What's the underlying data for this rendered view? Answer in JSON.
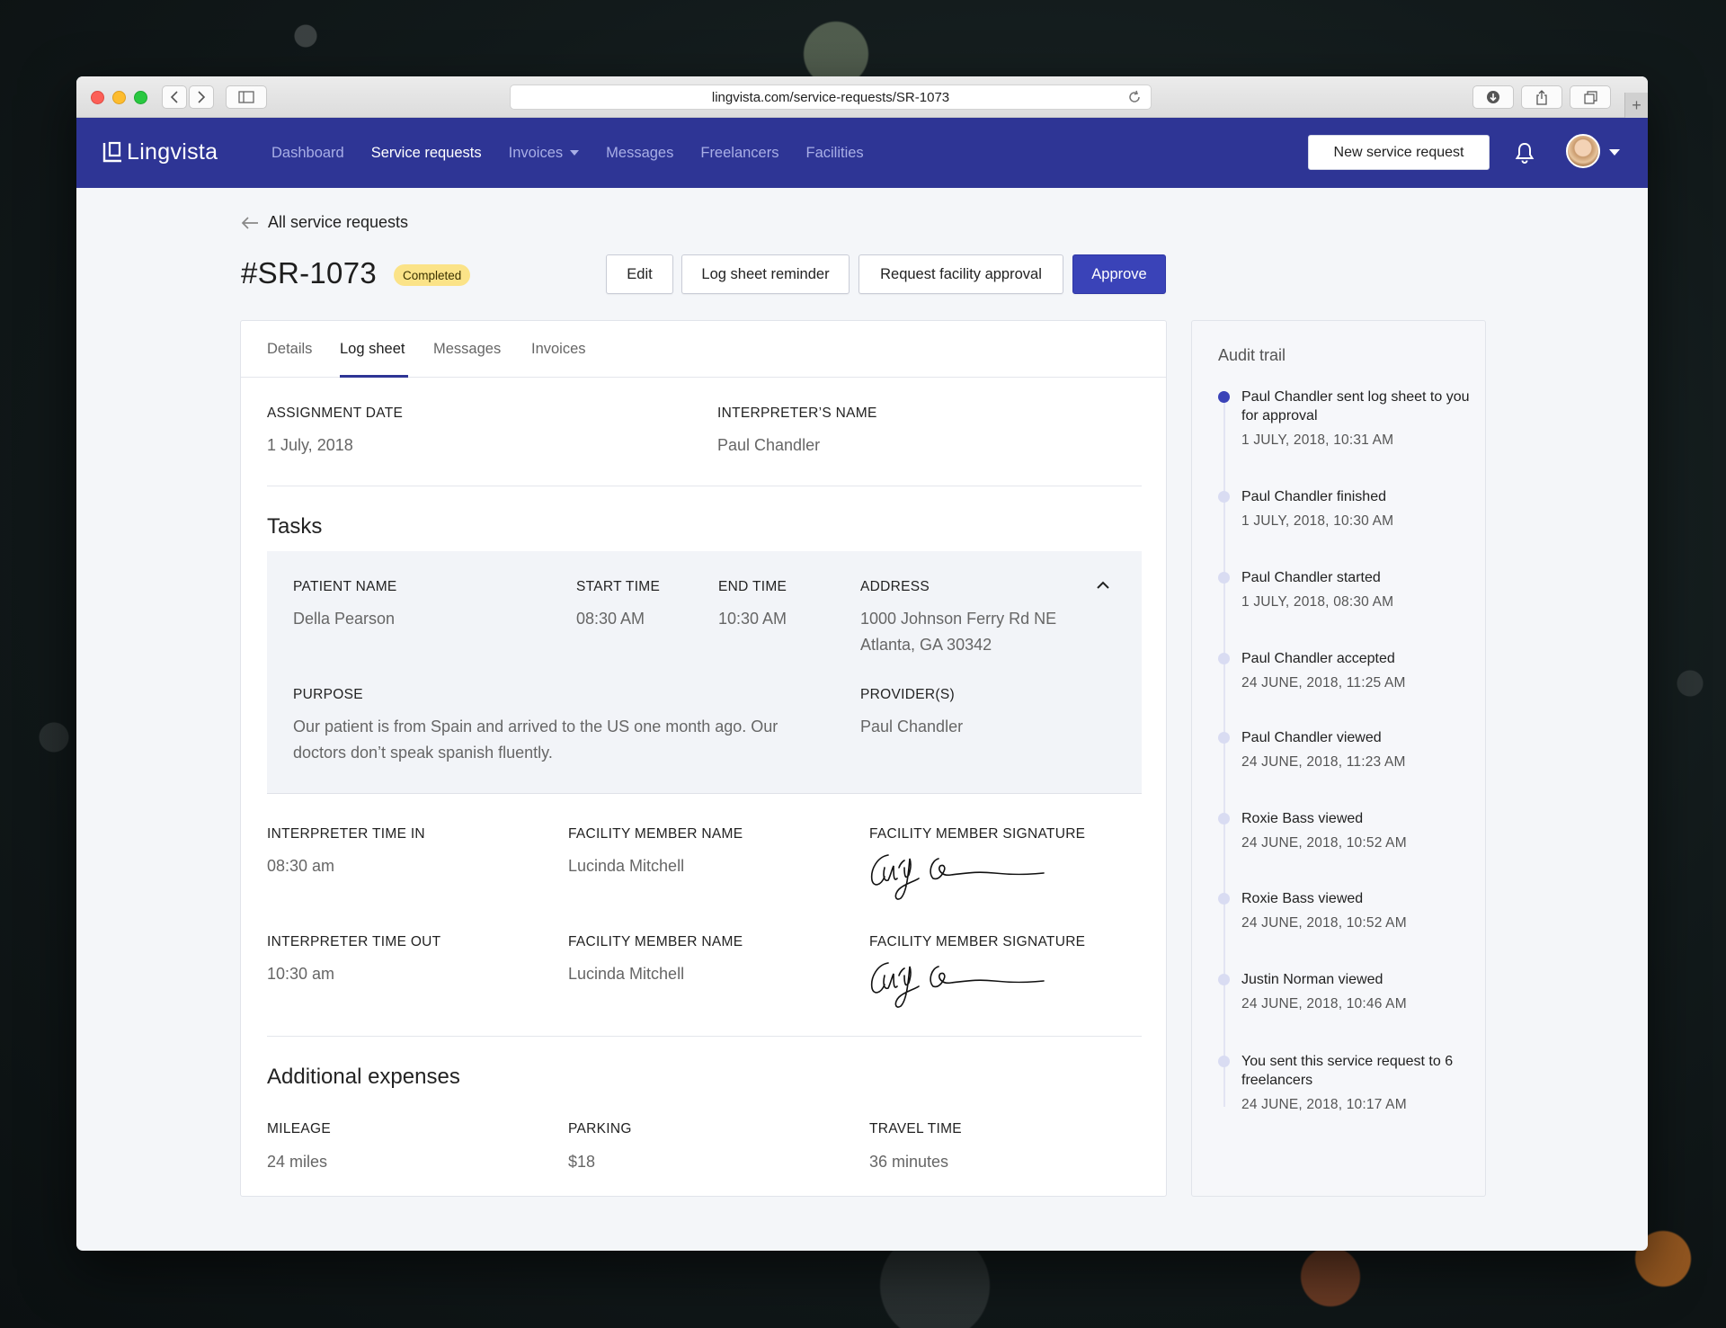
{
  "browser": {
    "url": "lingvista.com/service-requests/SR-1073"
  },
  "app": {
    "logo": "Lingvista",
    "nav": [
      {
        "label": "Dashboard"
      },
      {
        "label": "Service requests"
      },
      {
        "label": "Invoices"
      },
      {
        "label": "Messages"
      },
      {
        "label": "Freelancers"
      },
      {
        "label": "Facilities"
      }
    ],
    "new_request_label": "New service request"
  },
  "page": {
    "back_label": "All service requests",
    "title": "#SR-1073",
    "status": "Completed",
    "actions": {
      "edit": "Edit",
      "reminder": "Log sheet reminder",
      "facility_approval": "Request facility approval",
      "approve": "Approve"
    },
    "tabs": [
      "Details",
      "Log sheet",
      "Messages",
      "Invoices"
    ]
  },
  "log_sheet": {
    "assignment_date_label": "ASSIGNMENT DATE",
    "assignment_date": "1 July, 2018",
    "interpreter_label": "INTERPRETER’S NAME",
    "interpreter": "Paul Chandler",
    "tasks_title": "Tasks",
    "task": {
      "patient_label": "PATIENT NAME",
      "patient": "Della Pearson",
      "start_label": "START TIME",
      "start": "08:30 AM",
      "end_label": "END TIME",
      "end": "10:30 AM",
      "address_label": "ADDRESS",
      "address_line1": "1000 Johnson Ferry Rd NE",
      "address_line2": "Atlanta, GA 30342",
      "purpose_label": "PURPOSE",
      "purpose_line1": "Our patient is from Spain and arrived to the US one month ago. Our",
      "purpose_line2": "doctors don’t speak spanish fluently.",
      "providers_label": "PROVIDER(S)",
      "providers": "Paul Chandler"
    },
    "time_in": {
      "label": "INTERPRETER TIME IN",
      "value": "08:30 am",
      "member_label": "FACILITY MEMBER NAME",
      "member": "Lucinda Mitchell",
      "signature_label": "FACILITY MEMBER SIGNATURE"
    },
    "time_out": {
      "label": "INTERPRETER TIME OUT",
      "value": "10:30 am",
      "member_label": "FACILITY MEMBER NAME",
      "member": "Lucinda Mitchell",
      "signature_label": "FACILITY MEMBER SIGNATURE"
    },
    "expenses_title": "Additional expenses",
    "expenses": {
      "mileage_label": "MILEAGE",
      "mileage": "24 miles",
      "parking_label": "PARKING",
      "parking": "$18",
      "travel_label": "TRAVEL TIME",
      "travel": "36 minutes"
    }
  },
  "audit": {
    "title": "Audit trail",
    "events": [
      {
        "text": "Paul Chandler sent log sheet to you for approval",
        "time": "1 JULY, 2018, 10:31 AM"
      },
      {
        "text": "Paul Chandler finished",
        "time": "1 JULY, 2018, 10:30 AM"
      },
      {
        "text": "Paul Chandler started",
        "time": "1 JULY, 2018, 08:30 AM"
      },
      {
        "text": "Paul Chandler accepted",
        "time": "24 JUNE, 2018, 11:25 AM"
      },
      {
        "text": "Paul Chandler viewed",
        "time": "24 JUNE, 2018, 11:23 AM"
      },
      {
        "text": "Roxie Bass viewed",
        "time": "24 JUNE, 2018, 10:52 AM"
      },
      {
        "text": "Roxie Bass viewed",
        "time": "24 JUNE, 2018, 10:52 AM"
      },
      {
        "text": "Justin Norman viewed",
        "time": "24 JUNE, 2018, 10:46 AM"
      },
      {
        "text": "You sent this service request to 6 freelancers",
        "time": "24 JUNE, 2018, 10:17 AM"
      }
    ]
  },
  "colors": {
    "brand": "#2e3595",
    "primary_button": "#3a43b8",
    "badge": "#fbe388"
  },
  "icons": [
    "back-icon",
    "forward-icon",
    "sidebar-icon",
    "reload-icon",
    "download-icon",
    "share-icon",
    "tabs-icon",
    "bell-icon",
    "arrow-left-icon",
    "chevron-up-icon",
    "signature-image"
  ]
}
